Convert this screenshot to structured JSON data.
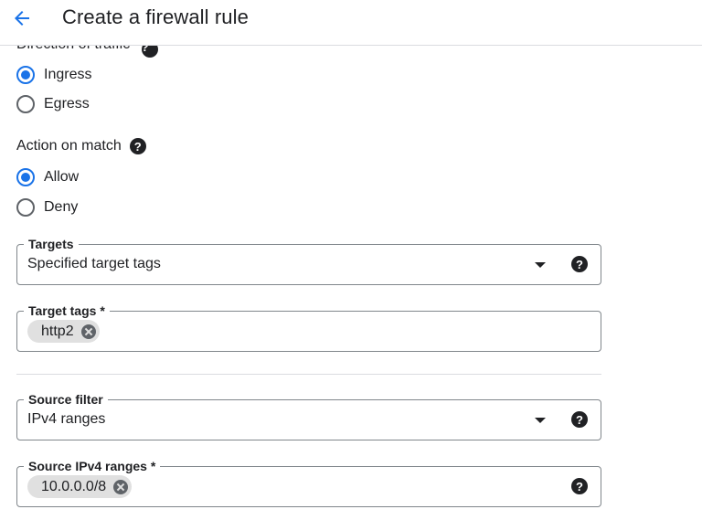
{
  "header": {
    "title": "Create a firewall rule",
    "back_icon": "arrow-back-icon"
  },
  "direction": {
    "title": "Direction of traffic",
    "options": [
      {
        "label": "Ingress",
        "checked": true
      },
      {
        "label": "Egress",
        "checked": false
      }
    ]
  },
  "action": {
    "title": "Action on match",
    "options": [
      {
        "label": "Allow",
        "checked": true
      },
      {
        "label": "Deny",
        "checked": false
      }
    ]
  },
  "targets": {
    "label": "Targets",
    "value": "Specified target tags"
  },
  "target_tags": {
    "label": "Target tags *",
    "chips": [
      "http2"
    ]
  },
  "source_filter": {
    "label": "Source filter",
    "value": "IPv4 ranges"
  },
  "source_ranges": {
    "label": "Source IPv4 ranges *",
    "chips": [
      "10.0.0.0/8"
    ]
  },
  "help_glyph": "?",
  "colors": {
    "accent": "#1a73e8",
    "text": "#202124",
    "border": "#80868b",
    "chip_bg": "#e0e0e0"
  }
}
